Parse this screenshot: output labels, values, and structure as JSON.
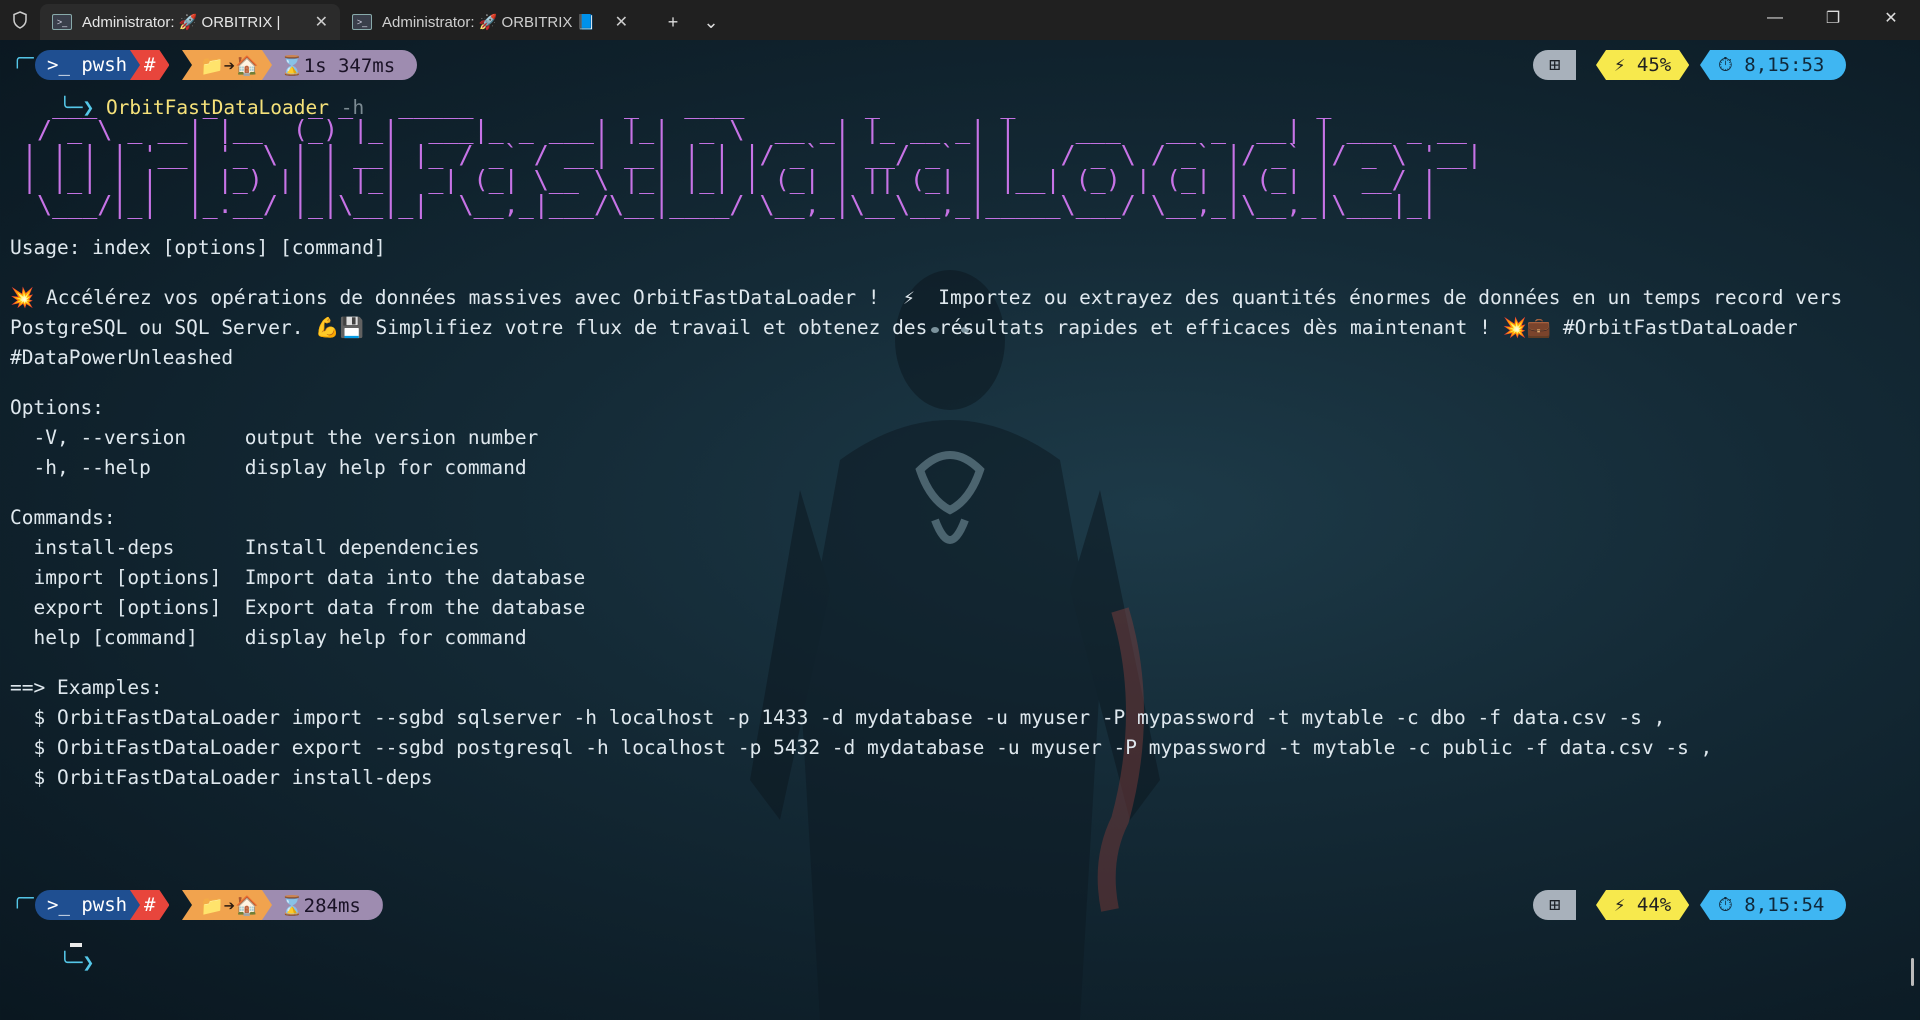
{
  "titlebar": {
    "tabs": [
      {
        "label": "Administrator: 🚀 ORBITRIX |",
        "active": true
      },
      {
        "label": "Administrator: 🚀 ORBITRIX 📘",
        "active": false
      }
    ],
    "new_tab": "+",
    "dropdown": "⌄",
    "minimize": "—",
    "maximize": "❐",
    "close": "✕"
  },
  "prompt1": {
    "shell": "pwsh",
    "admin_glyph": "#",
    "path_glyph": "📁➔🏠",
    "duration": "⌛1s 347ms",
    "os_glyph": "⊞",
    "battery": "⚡ 45%",
    "time": "⏱ 8,15:53",
    "command": "OrbitFastDataLoader",
    "arg": "-h"
  },
  "ascii_banner": "  ___       _      _ _   _____          _   ____        _        _                    _            \n / _ \\ _ __| |__  (_) |_|  ___|_ _ ___| |_|  _ \\  __ _| |_ __ _| |    ___   __ _  __| | ___ _ __ \n| | | | '__| '_ \\ | | __| |_ / _` / __| __| | | |/ _` | __/ _` | |   / _ \\ / _` |/ _` |/ _ \\ '__|\n| |_| | |  | |_) || | |_|  _| (_| \\__ \\ |_| |_| | (_| | || (_| | |__| (_) | (_| | (_| |  __/ |   \n \\___/|_|  |_.__/ |_|\\__|_|  \\__,_|___/\\__|____/ \\__,_|\\__\\__,_|_____\\___/ \\__,_|\\__,_|\\___|_|   ",
  "usage": "Usage: index [options] [command]",
  "description": [
    "💥 Accélérez vos opérations de données massives avec OrbitFastDataLoader !  ⚡  Importez ou extrayez des quantités énormes de données en un temps record vers",
    "PostgreSQL ou SQL Server. 💪💾 Simplifiez votre flux de travail et obtenez des résultats rapides et efficaces dès maintenant ! 💥💼 #OrbitFastDataLoader",
    "#DataPowerUnleashed"
  ],
  "options_header": "Options:",
  "options": [
    "  -V, --version     output the version number",
    "  -h, --help        display help for command"
  ],
  "commands_header": "Commands:",
  "commands": [
    "  install-deps      Install dependencies",
    "  import [options]  Import data into the database",
    "  export [options]  Export data from the database",
    "  help [command]    display help for command"
  ],
  "examples_header": "==> Examples:",
  "examples": [
    "  $ OrbitFastDataLoader import --sgbd sqlserver -h localhost -p 1433 -d mydatabase -u myuser -P mypassword -t mytable -c dbo -f data.csv -s ,",
    "  $ OrbitFastDataLoader export --sgbd postgresql -h localhost -p 5432 -d mydatabase -u myuser -P mypassword -t mytable -c public -f data.csv -s ,",
    "  $ OrbitFastDataLoader install-deps"
  ],
  "prompt2": {
    "shell": "pwsh",
    "admin_glyph": "#",
    "path_glyph": "📁➔🏠",
    "duration": "⌛284ms",
    "os_glyph": "⊞",
    "battery": "⚡ 44%",
    "time": "⏱ 8,15:54"
  },
  "colors": {
    "accent_blue": "#1f4f91",
    "ascii_purple": "#c773e6",
    "command_yellow": "#f6e27a"
  }
}
